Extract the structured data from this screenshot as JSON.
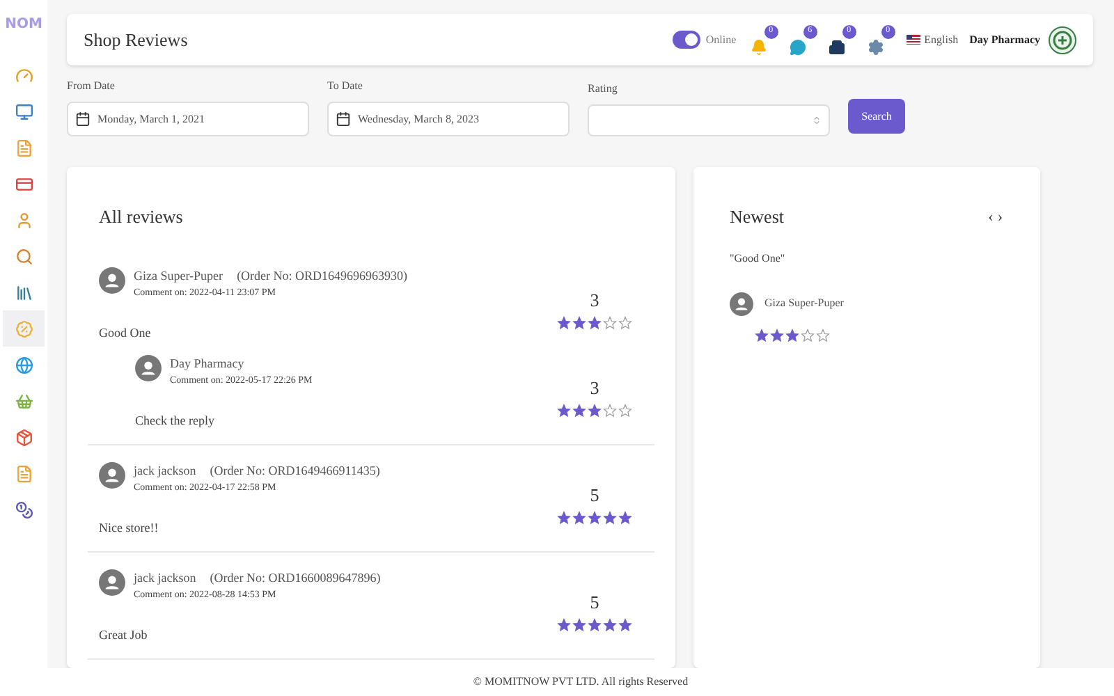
{
  "sidebar": {
    "logo": "NOM",
    "items": [
      {
        "kind": "gauge",
        "selected": false
      },
      {
        "kind": "monitor",
        "selected": false
      },
      {
        "kind": "document",
        "selected": false
      },
      {
        "kind": "card",
        "selected": false
      },
      {
        "kind": "person",
        "selected": false
      },
      {
        "kind": "search",
        "selected": false
      },
      {
        "kind": "books",
        "selected": false
      },
      {
        "kind": "badge",
        "selected": true
      },
      {
        "kind": "globe",
        "selected": false
      },
      {
        "kind": "basket",
        "selected": false
      },
      {
        "kind": "box",
        "selected": false
      },
      {
        "kind": "document",
        "selected": false
      },
      {
        "kind": "coin",
        "selected": false
      }
    ]
  },
  "header": {
    "title": "Shop Reviews",
    "status": {
      "label": "Online",
      "on": true
    },
    "notifications": [
      {
        "kind": "bell",
        "count": "0"
      },
      {
        "kind": "chat",
        "count": "6"
      },
      {
        "kind": "building",
        "count": "0"
      },
      {
        "kind": "gear",
        "count": "0"
      }
    ],
    "language": "English",
    "shop_name": "Day Pharmacy"
  },
  "filters": {
    "from": {
      "label": "From Date",
      "value": "Monday, March 1, 2021"
    },
    "to": {
      "label": "To Date",
      "value": "Wednesday, March 8, 2023"
    },
    "rating": {
      "label": "Rating"
    },
    "button": "Search"
  },
  "reviews": {
    "title": "All reviews",
    "items": [
      {
        "name": "Giza Super-Puper",
        "order": "(Order No: ORD1649696963930)",
        "date": "Comment on: 2022-04-11 23:07 PM",
        "comment": "Good One",
        "rating": "3",
        "stars": 3,
        "reply": {
          "name": "Day Pharmacy",
          "date": "Comment on: 2022-05-17 22:26 PM",
          "comment": "Check the reply",
          "rating": "3",
          "stars": 3
        }
      },
      {
        "name": "jack jackson",
        "order": "(Order No: ORD1649466911435)",
        "date": "Comment on: 2022-04-17 22:58 PM",
        "comment": "Nice store!!",
        "rating": "5",
        "stars": 5
      },
      {
        "name": "jack jackson",
        "order": "(Order No: ORD1660089647896)",
        "date": "Comment on: 2022-08-28 14:53 PM",
        "comment": "Great Job",
        "rating": "5",
        "stars": 5
      }
    ]
  },
  "newest": {
    "title": "Newest",
    "prev": "‹",
    "next": "›",
    "quote": "\"Good One\"",
    "name": "Giza Super-Puper",
    "stars": 3
  },
  "footer": "© MOMITNOW PVT LTD. All rights Reserved"
}
